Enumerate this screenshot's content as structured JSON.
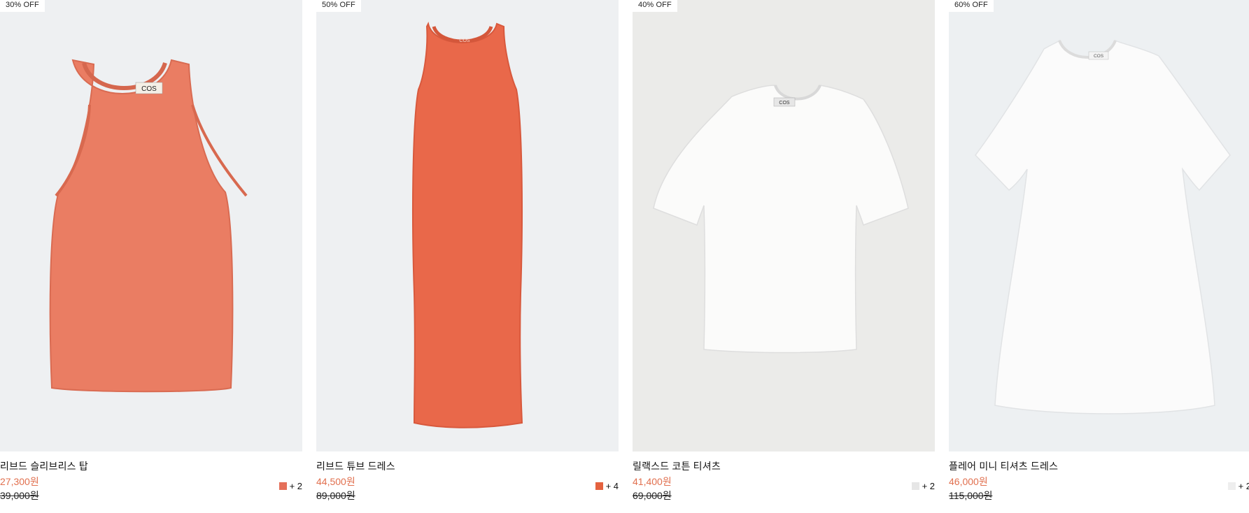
{
  "products": [
    {
      "badge": "30% OFF",
      "name": "리브드 슬리브리스 탑",
      "sale_price": "27,300원",
      "original_price": "39,000원",
      "swatch_color": "#e5705a",
      "swatch_more": "+ 2",
      "image_bg": "#eef0f2",
      "garment_color": "#ea7d63",
      "label_text": "COS"
    },
    {
      "badge": "50% OFF",
      "name": "리브드 튜브 드레스",
      "sale_price": "44,500원",
      "original_price": "89,000원",
      "swatch_color": "#e4623f",
      "swatch_more": "+ 4",
      "image_bg": "#eef0f2",
      "garment_color": "#e9684a",
      "label_text": "COS"
    },
    {
      "badge": "40% OFF",
      "name": "릴랙스드 코튼 티셔츠",
      "sale_price": "41,400원",
      "original_price": "69,000원",
      "swatch_color": "#e6e6e6",
      "swatch_more": "+ 2",
      "image_bg": "#ebebe9",
      "garment_color": "#fbfbfa",
      "label_text": "COS"
    },
    {
      "badge": "60% OFF",
      "name": "플레어 미니 티셔츠 드레스",
      "sale_price": "46,000원",
      "original_price": "115,000원",
      "swatch_color": "#eeeeee",
      "swatch_more": "+ 2",
      "image_bg": "#edf0f2",
      "garment_color": "#fbfbfb",
      "label_text": "COS"
    }
  ]
}
